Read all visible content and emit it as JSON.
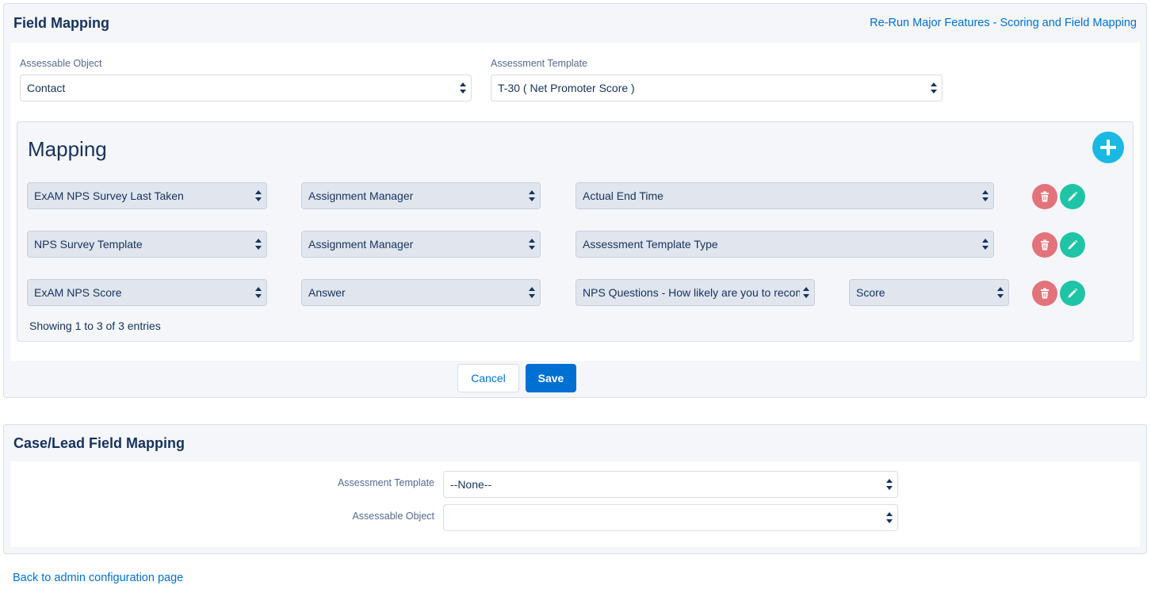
{
  "field_mapping": {
    "title": "Field Mapping",
    "rerun_link": "Re-Run Major Features - Scoring and Field Mapping",
    "assessable_object": {
      "label": "Assessable Object",
      "value": "Contact"
    },
    "assessment_template": {
      "label": "Assessment Template",
      "value": "T-30 ( Net Promoter Score )"
    },
    "mapping": {
      "title": "Mapping",
      "rows": [
        {
          "source": "ExAM NPS Survey Last Taken",
          "object": "Assignment Manager",
          "field": "Actual End Time"
        },
        {
          "source": "NPS Survey Template",
          "object": "Assignment Manager",
          "field": "Assessment Template Type"
        },
        {
          "source": "ExAM NPS Score",
          "object": "Answer",
          "field": "NPS Questions - How likely are you to recommend",
          "sub_field": "Score"
        }
      ],
      "showing": "Showing 1 to 3 of 3 entries"
    },
    "cancel_label": "Cancel",
    "save_label": "Save"
  },
  "case_lead_mapping": {
    "title": "Case/Lead Field Mapping",
    "assessment_template": {
      "label": "Assessment Template",
      "value": "--None--"
    },
    "assessable_object": {
      "label": "Assessable Object",
      "value": ""
    }
  },
  "back_link": "Back to admin configuration page",
  "colors": {
    "accent": "#0070d2",
    "add": "#1ab9e3",
    "delete": "#e3737a",
    "edit": "#1fc4a6"
  },
  "icons": {
    "add": "plus-icon",
    "delete": "trash-icon",
    "edit": "pencil-icon",
    "select": "up-down-arrows-icon"
  }
}
